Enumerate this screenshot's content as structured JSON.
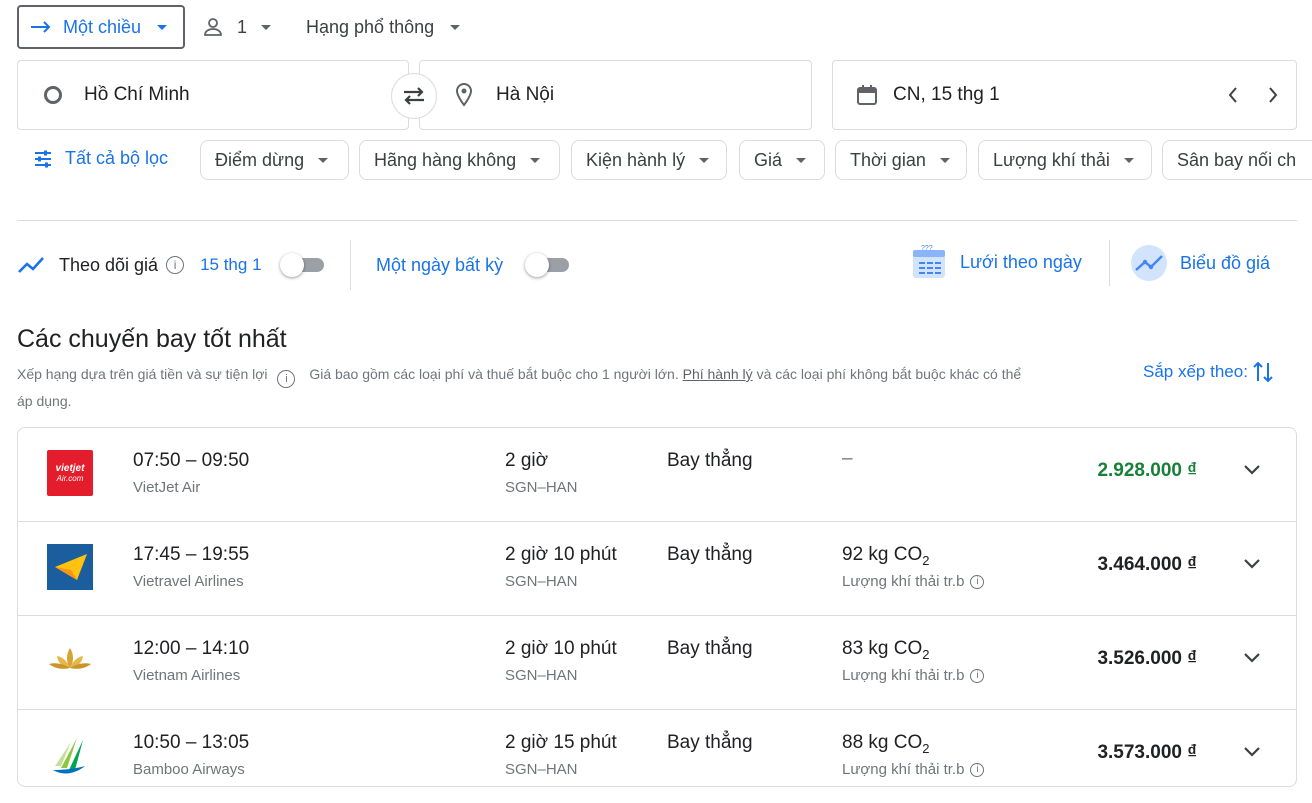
{
  "top_bar": {
    "trip_type": "Một chiều",
    "passengers": "1",
    "cabin_class": "Hạng phổ thông"
  },
  "search": {
    "origin": "Hồ Chí Minh",
    "destination": "Hà Nội",
    "date": "CN, 15 thg 1"
  },
  "filters": {
    "all_filters": "Tất cả bộ lọc",
    "chips": [
      "Điểm dừng",
      "Hãng hàng không",
      "Kiện hành lý",
      "Giá",
      "Thời gian",
      "Lượng khí thải",
      "Sân bay nối ch"
    ]
  },
  "tracking": {
    "track_label": "Theo dõi giá",
    "track_date": "15 thg 1",
    "any_date_label": "Một ngày bất kỳ",
    "date_grid_label": "Lưới theo ngày",
    "price_graph_label": "Biểu đồ giá"
  },
  "results": {
    "heading": "Các chuyến bay tốt nhất",
    "subtitle_prefix": "Xếp hạng dựa trên giá tiền và sự tiện lợi",
    "subtitle_text_1": "Giá bao gồm các loại phí và thuế bắt buộc cho 1 người lớn.",
    "subtitle_link": "Phí hành lý",
    "subtitle_text_2": "và các loại phí không bắt buộc khác có thể",
    "subtitle_text_3": "áp dụng.",
    "sort_label": "Sắp xếp theo:"
  },
  "flights": [
    {
      "time": "07:50 – 09:50",
      "airline": "VietJet Air",
      "duration": "2 giờ",
      "route": "SGN–HAN",
      "stops": "Bay thẳng",
      "emissions": "–",
      "emissions_value": "",
      "emissions_unit": "",
      "emissions_sub": "",
      "emissions_label": "",
      "price": "2.928.000 ₫",
      "price_color": "#188038"
    },
    {
      "time": "17:45 – 19:55",
      "airline": "Vietravel Airlines",
      "duration": "2 giờ 10 phút",
      "route": "SGN–HAN",
      "stops": "Bay thẳng",
      "emissions": "",
      "emissions_value": "92 kg CO",
      "emissions_unit": "2",
      "emissions_sub": "",
      "emissions_label": "Lượng khí thải tr.b",
      "price": "3.464.000 ₫",
      "price_color": "#202124"
    },
    {
      "time": "12:00 – 14:10",
      "airline": "Vietnam Airlines",
      "duration": "2 giờ 10 phút",
      "route": "SGN–HAN",
      "stops": "Bay thẳng",
      "emissions": "",
      "emissions_value": "83 kg CO",
      "emissions_unit": "2",
      "emissions_sub": "",
      "emissions_label": "Lượng khí thải tr.b",
      "price": "3.526.000 ₫",
      "price_color": "#202124"
    },
    {
      "time": "10:50 – 13:05",
      "airline": "Bamboo Airways",
      "duration": "2 giờ 15 phút",
      "route": "SGN–HAN",
      "stops": "Bay thẳng",
      "emissions": "",
      "emissions_value": "88 kg CO",
      "emissions_unit": "2",
      "emissions_sub": "",
      "emissions_label": "Lượng khí thải tr.b",
      "price": "3.573.000 ₫",
      "price_color": "#202124"
    }
  ]
}
